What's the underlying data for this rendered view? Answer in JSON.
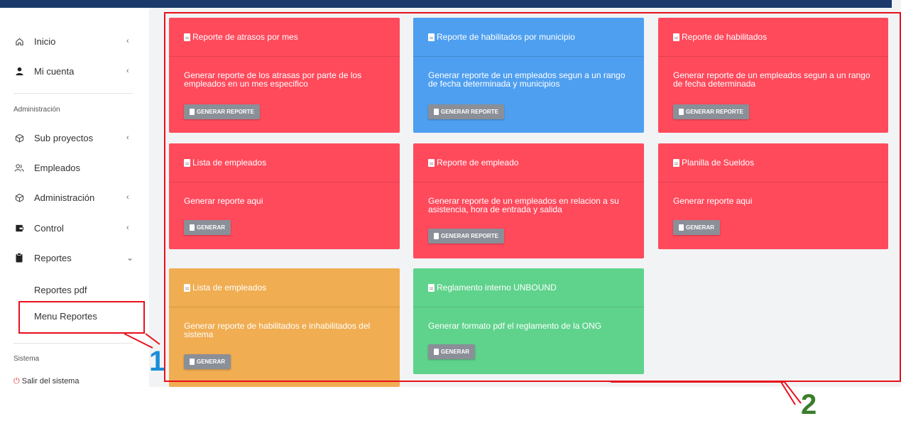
{
  "sidebar": {
    "items": [
      {
        "label": "Inicio",
        "icon": "home-icon",
        "chevron": "‹"
      },
      {
        "label": "Mi cuenta",
        "icon": "user-icon",
        "chevron": "‹"
      }
    ],
    "section_admin": "Administración",
    "admin_items": [
      {
        "label": "Sub proyectos",
        "icon": "cube-icon",
        "chevron": "‹"
      },
      {
        "label": "Empleados",
        "icon": "users-icon",
        "chevron": ""
      },
      {
        "label": "Administración",
        "icon": "cube-icon",
        "chevron": "‹"
      },
      {
        "label": "Control",
        "icon": "wallet-icon",
        "chevron": "‹"
      },
      {
        "label": "Reportes",
        "icon": "clipboard-icon",
        "chevron": "⌄"
      }
    ],
    "sub_items": [
      "Reportes pdf",
      "Menu Reportes"
    ],
    "section_system": "Sistema",
    "logout": "Salir del sistema"
  },
  "cards": [
    {
      "title": "Reporte de atrasos por mes",
      "body": "Generar reporte de los atrasas por parte de los empleados en un mes especifico",
      "button": "GENERAR REPORTE",
      "color": "#ff4a5c"
    },
    {
      "title": "Reporte de habilitados por municipio",
      "body": "Generar reporte de un empleados segun a un rango de fecha determinada y municipios",
      "button": "GENERAR REPORTE",
      "color": "#4e9ff0"
    },
    {
      "title": "Reporte de habilitados",
      "body": "Generar reporte de un empleados segun a un rango de fecha determinada",
      "button": "GENERAR REPORTE",
      "color": "#ff4a5c"
    },
    {
      "title": "Lista de empleados",
      "body": "Generar reporte aqui",
      "button": "GENERAR",
      "color": "#ff4a5c"
    },
    {
      "title": "Reporte de empleado",
      "body": "Generar reporte de un empleados en relacion a su asistencia, hora de entrada y salida",
      "button": "GENERAR REPORTE",
      "color": "#ff4a5c"
    },
    {
      "title": "Planilla de Sueldos",
      "body": "Generar reporte aqui",
      "button": "GENERAR",
      "color": "#ff4a5c"
    },
    {
      "title": "Lista de empleados",
      "body": "Generar reporte de habilitados e inhabilitados del sistema",
      "button": "GENERAR",
      "color": "#f0ad51"
    },
    {
      "title": "Reglamento interno UNBOUND",
      "body": "Generar formato pdf el reglamento de la ONG",
      "button": "GENERAR",
      "color": "#5fd38c"
    }
  ],
  "annotations": [
    {
      "label": "1",
      "color": "#1a8fd8"
    },
    {
      "label": "2",
      "color": "#3a7d2c"
    }
  ]
}
